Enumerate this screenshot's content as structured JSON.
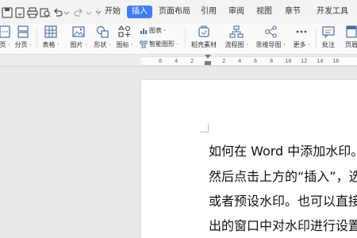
{
  "menubar": {
    "tabs": [
      "开始",
      "插入",
      "页面布局",
      "引用",
      "审阅",
      "视图",
      "章节",
      "开发工具"
    ],
    "active_tab": "插入",
    "accent_color": "#3f7df6"
  },
  "ribbon": {
    "items": [
      {
        "label": "页 ·",
        "icon": "page-break-icon"
      },
      {
        "label": "分页 ·",
        "icon": "page-split-icon"
      },
      {
        "label": "表格 ·",
        "icon": "table-icon"
      },
      {
        "label": "图片 ·",
        "icon": "picture-icon"
      },
      {
        "label": "形状 ·",
        "icon": "shapes-icon"
      },
      {
        "label": "图标 ·",
        "icon": "icons-icon"
      },
      {
        "label": "稻壳素材",
        "icon": "material-icon"
      },
      {
        "label": "流程图 ·",
        "icon": "flowchart-icon"
      },
      {
        "label": "思维导图 ·",
        "icon": "mindmap-icon"
      },
      {
        "label": "更多 ·",
        "icon": "more-icon"
      },
      {
        "label": "批注",
        "icon": "comment-icon"
      },
      {
        "label": "页眉",
        "icon": "header-icon"
      }
    ],
    "chart_label": "图表 ·",
    "smart_shape_label": "智能图形 ·"
  },
  "ruler": {
    "ticks": [
      "6",
      "4",
      "2",
      "2",
      "4",
      "6",
      "8",
      "10",
      "12",
      "14",
      "16"
    ]
  },
  "document": {
    "lines": [
      "如何在 Word 中添加水印。",
      "然后点击上方的“插入”，选",
      "或者预设水印。也可以直接",
      "出的窗口中对水印进行设置。"
    ]
  }
}
